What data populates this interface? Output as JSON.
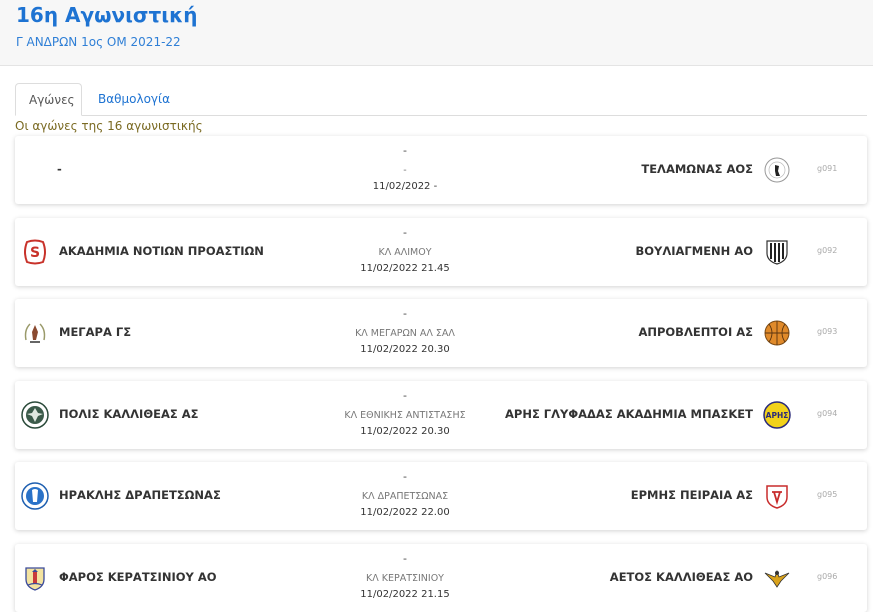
{
  "header": {
    "title": "16η Αγωνιστική",
    "subtitle": "Γ ΑΝΔΡΩΝ 1ος ΟΜ 2021-22"
  },
  "tabs": [
    {
      "label": "Αγώνες",
      "active": true
    },
    {
      "label": "Βαθμολογία",
      "active": false
    }
  ],
  "intro": "Οι αγώνες της 16 αγωνιστικής",
  "games": [
    {
      "home": "-",
      "home_logo": "none",
      "score": "-",
      "venue": "-",
      "datetime": "11/02/2022 -",
      "away": "ΤΕΛΑΜΩΝΑΣ ΑΟΣ",
      "away_logo": "telamonas-logo",
      "code": "g091"
    },
    {
      "home": "ΑΚΑΔΗΜΙΑ ΝΟΤΙΩΝ ΠΡΟΑΣΤΙΩΝ",
      "home_logo": "s-logo",
      "score": "-",
      "venue": "ΚΛ ΑΛΙΜΟΥ",
      "datetime": "11/02/2022 21.45",
      "away": "ΒΟΥΛΙΑΓΜΕΝΗ ΑΟ",
      "away_logo": "striped-shield-logo",
      "code": "g092"
    },
    {
      "home": "ΜΕΓΑΡΑ ΓΣ",
      "home_logo": "megara-logo",
      "score": "-",
      "venue": "ΚΛ ΜΕΓΑΡΩΝ ΑΛ ΣΑΛ",
      "datetime": "11/02/2022 20.30",
      "away": "ΑΠΡΟΒΛΕΠΤΟΙ ΑΣ",
      "away_logo": "basketball-logo",
      "code": "g093"
    },
    {
      "home": "ΠΟΛΙΣ ΚΑΛΛΙΘΕΑΣ ΑΣ",
      "home_logo": "polis-logo",
      "score": "-",
      "venue": "ΚΛ ΕΘΝΙΚΗΣ ΑΝΤΙΣΤΑΣΗΣ",
      "datetime": "11/02/2022 20.30",
      "away": "ΑΡΗΣ ΓΛΥΦΑΔΑΣ ΑΚΑΔΗΜΙΑ ΜΠΑΣΚΕΤ",
      "away_logo": "aris-logo",
      "code": "g094"
    },
    {
      "home": "ΗΡΑΚΛΗΣ ΔΡΑΠΕΤΣΩΝΑΣ",
      "home_logo": "iraklis-logo",
      "score": "-",
      "venue": "ΚΛ ΔΡΑΠΕΤΣΩΝΑΣ",
      "datetime": "11/02/2022 22.00",
      "away": "ΕΡΜΗΣ ΠΕΙΡΑΙΑ ΑΣ",
      "away_logo": "ermis-logo",
      "code": "g095"
    },
    {
      "home": "ΦΑΡΟΣ ΚΕΡΑΤΣΙΝΙΟΥ ΑΟ",
      "home_logo": "faros-logo",
      "score": "-",
      "venue": "ΚΛ ΚΕΡΑΤΣΙΝΙΟΥ",
      "datetime": "11/02/2022 21.15",
      "away": "ΑΕΤΟΣ ΚΑΛΛΙΘΕΑΣ ΑΟ",
      "away_logo": "aetos-logo",
      "code": "g096"
    }
  ]
}
